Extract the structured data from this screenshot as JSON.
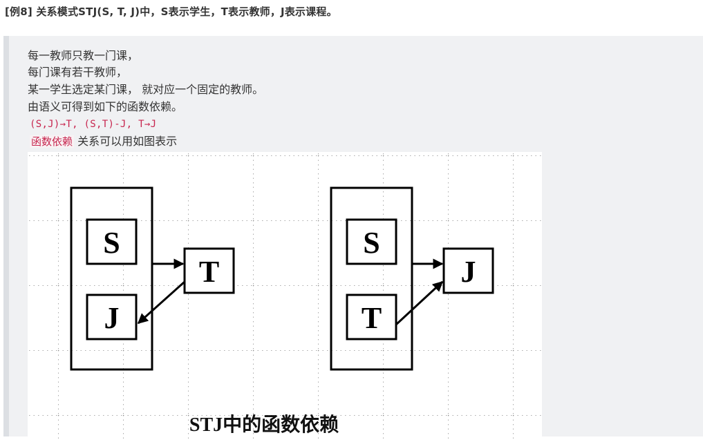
{
  "heading": "[例8] 关系模式STJ(S, T, J)中，S表示学生，T表示教师，J表示课程。",
  "quote": {
    "lines": [
      "每一教师只教一门课，",
      "每门课有若干教师，",
      "某一学生选定某门课， 就对应一个固定的教师。",
      "由语义可得到如下的函数依赖。"
    ],
    "code_line": "(S,J)→T, (S,T)-J, T→J",
    "highlight": "函数依赖",
    "tail": " 关系可以用如图表示"
  },
  "figure": {
    "left_diagram": {
      "inner_top": "S",
      "inner_bottom": "J",
      "outer": "T"
    },
    "right_diagram": {
      "inner_top": "S",
      "inner_bottom": "T",
      "outer": "J"
    },
    "caption": "STJ中的函数依赖"
  }
}
